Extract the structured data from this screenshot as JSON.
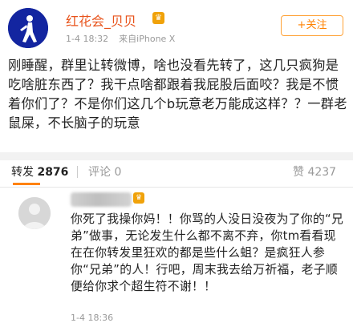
{
  "post": {
    "username": "红花会_贝贝",
    "vip_icon": "crown-icon",
    "timestamp": "1-4 18:32",
    "source": "来自iPhone X",
    "follow_label": "+关注",
    "content": "刚睡醒，群里让转微博，啥也没看先转了，这几只疯狗是吃啥脏东西了？我干点啥都跟着我屁股后面咬？我是不惯着你们了？不是你们这几个b玩意老万能成这样？？一群老鼠屎，不长脑子的玩意"
  },
  "tabs": {
    "repost_label": "转发",
    "repost_count": "2876",
    "comments_label": "评论",
    "comments_count": "0",
    "likes_label": "赞",
    "likes_count": "4237"
  },
  "repost_item": {
    "text": "你死了我操你妈！！你骂的人没日没夜为了你的“兄弟”做事，无论发生什么都不离不弃，你tm看看现在在你转发里狂欢的都是些什么蛆？是疯狂人参你“兄弟”的人！行吧，周末我去给万祈福，老子顺便给你求个超生符不谢！！",
    "timestamp": "1-4 18:36"
  }
}
